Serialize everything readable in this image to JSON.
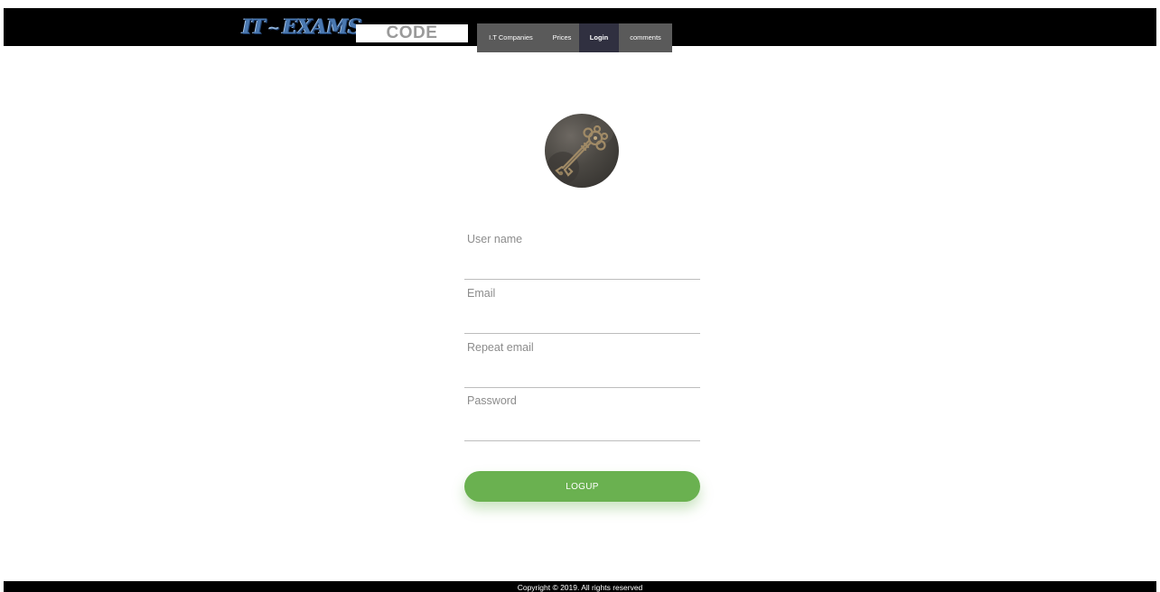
{
  "header": {
    "logo": {
      "left": "IT",
      "separator": "~",
      "right": "EXAMS"
    },
    "code_label": "CODE",
    "nav": [
      {
        "label": "I.T Companies",
        "active": false
      },
      {
        "label": "Prices",
        "active": false
      },
      {
        "label": "Login",
        "active": true
      },
      {
        "label": "comments",
        "active": false
      }
    ]
  },
  "avatar": {
    "icon": "key-icon"
  },
  "form": {
    "username": {
      "placeholder": "User name",
      "value": ""
    },
    "email": {
      "placeholder": "Email",
      "value": ""
    },
    "repeat_email": {
      "placeholder": "Repeat email",
      "value": ""
    },
    "password": {
      "placeholder": "Password",
      "value": ""
    },
    "submit_label": "LOGUP"
  },
  "footer": {
    "copyright": "Copyright © 2019. All rights reserved"
  },
  "colors": {
    "topbar": "#000000",
    "nav_item": "#5a5a5a",
    "nav_active": "#303040",
    "submit": "#6ab150",
    "logo": "#4a78b0"
  }
}
